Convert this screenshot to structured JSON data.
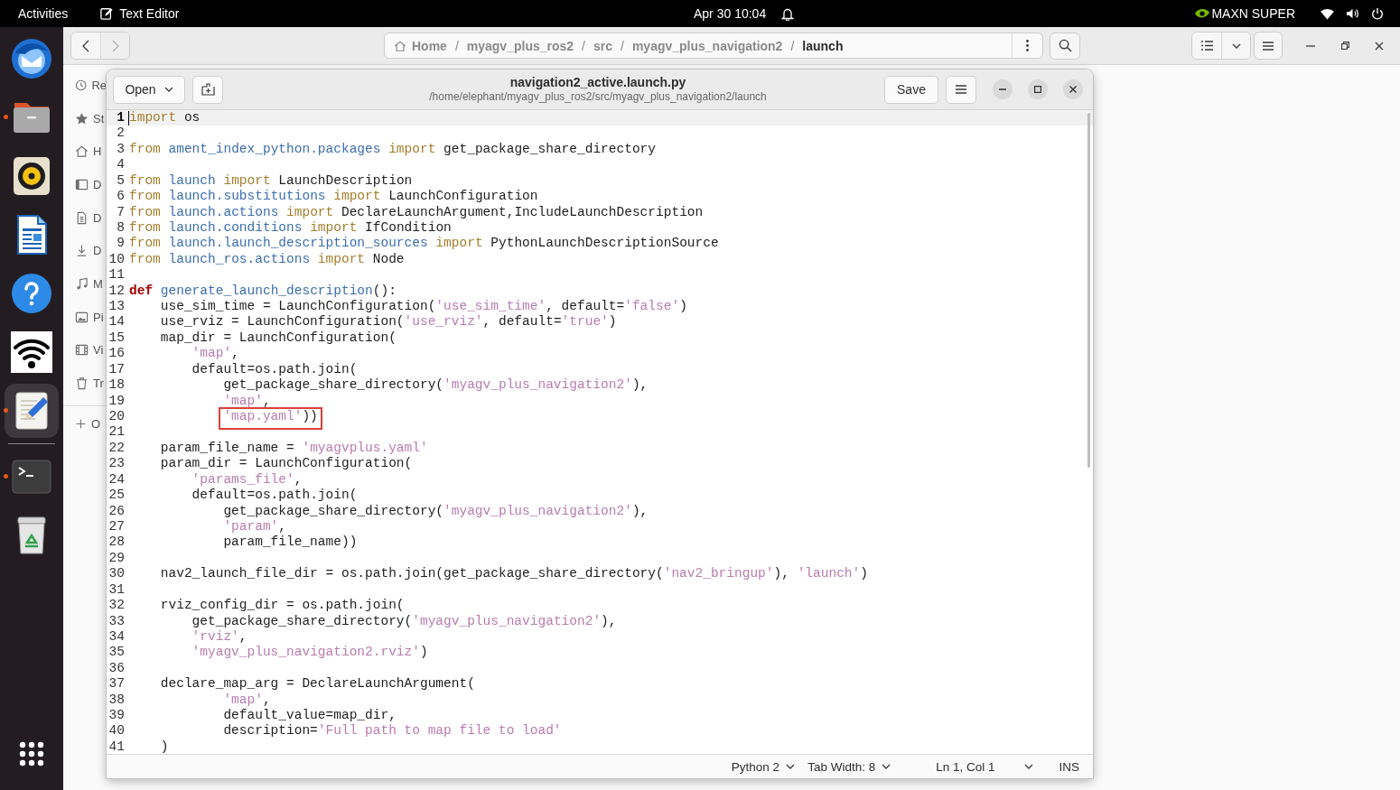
{
  "top_bar": {
    "activities": "Activities",
    "app_name": "Text Editor",
    "clock": "Apr 30 10:04",
    "power_mode": "MAXN SUPER"
  },
  "dock": {
    "favorites": [
      {
        "kind": "mail",
        "running": false,
        "selected": false
      },
      {
        "kind": "folder",
        "running": true,
        "selected": false
      },
      {
        "kind": "speaker",
        "running": false,
        "selected": false
      },
      {
        "kind": "document",
        "running": false,
        "selected": false
      },
      {
        "kind": "help",
        "running": false,
        "selected": false
      },
      {
        "kind": "wifi",
        "running": false,
        "selected": false
      },
      {
        "kind": "text-editor",
        "running": true,
        "selected": true
      }
    ],
    "others": [
      {
        "kind": "terminal",
        "running": true,
        "selected": false
      },
      {
        "kind": "trash",
        "running": false,
        "selected": false
      }
    ]
  },
  "file_manager": {
    "back_button": {
      "disabled": false
    },
    "forward_button": {
      "disabled": true
    },
    "path_bar": {
      "separator": "/",
      "segments": [
        {
          "kind": "home",
          "label": "Home",
          "selected": false
        },
        {
          "kind": "folder",
          "label": "myagv_plus_ros2",
          "selected": false
        },
        {
          "kind": "folder",
          "label": "src",
          "selected": false
        },
        {
          "kind": "folder",
          "label": "myagv_plus_navigation2",
          "selected": false
        },
        {
          "kind": "folder",
          "label": "launch",
          "selected": true
        }
      ]
    },
    "sidebar": [
      {
        "kind": "recent",
        "label": "Re"
      },
      {
        "kind": "starred",
        "label": "St"
      },
      {
        "kind": "home",
        "label": "H"
      },
      {
        "kind": "desktop",
        "label": "D"
      },
      {
        "kind": "documents",
        "label": "D"
      },
      {
        "kind": "downloads",
        "label": "D"
      },
      {
        "kind": "music",
        "label": "M"
      },
      {
        "kind": "pictures",
        "label": "Pi"
      },
      {
        "kind": "videos",
        "label": "Vi"
      },
      {
        "kind": "trash",
        "label": "Tr"
      },
      {
        "kind": "other",
        "label": "O"
      }
    ]
  },
  "editor": {
    "open_button": "Open",
    "title": "navigation2_active.launch.py",
    "path": "/home/elephant/myagv_plus_ros2/src/myagv_plus_navigation2/launch",
    "save_button": "Save",
    "lines": [
      {
        "no": "1",
        "current": true,
        "tokens": [
          {
            "kind": "keyword",
            "text": "import"
          },
          {
            "kind": "plain",
            "text": " os"
          }
        ]
      },
      {
        "no": "2",
        "current": false
      },
      {
        "no": "3",
        "current": false,
        "tokens": [
          {
            "kind": "keyword",
            "text": "from"
          },
          {
            "kind": "module",
            "text": " ament_index_python.packages"
          },
          {
            "kind": "keyword",
            "text": " import"
          },
          {
            "kind": "plain",
            "text": " get_package_share_directory"
          }
        ]
      },
      {
        "no": "4",
        "current": false
      },
      {
        "no": "5",
        "current": false,
        "tokens": [
          {
            "kind": "keyword",
            "text": "from"
          },
          {
            "kind": "module",
            "text": " launch"
          },
          {
            "kind": "keyword",
            "text": " import"
          },
          {
            "kind": "plain",
            "text": " LaunchDescription"
          }
        ]
      },
      {
        "no": "6",
        "current": false,
        "tokens": [
          {
            "kind": "keyword",
            "text": "from"
          },
          {
            "kind": "module",
            "text": " launch.substitutions"
          },
          {
            "kind": "keyword",
            "text": " import"
          },
          {
            "kind": "plain",
            "text": " LaunchConfiguration"
          }
        ]
      },
      {
        "no": "7",
        "current": false,
        "tokens": [
          {
            "kind": "keyword",
            "text": "from"
          },
          {
            "kind": "module",
            "text": " launch.actions"
          },
          {
            "kind": "keyword",
            "text": " import"
          },
          {
            "kind": "plain",
            "text": " DeclareLaunchArgument,IncludeLaunchDescription"
          }
        ]
      },
      {
        "no": "8",
        "current": false,
        "tokens": [
          {
            "kind": "keyword",
            "text": "from"
          },
          {
            "kind": "module",
            "text": " launch.conditions"
          },
          {
            "kind": "keyword",
            "text": " import"
          },
          {
            "kind": "plain",
            "text": " IfCondition"
          }
        ]
      },
      {
        "no": "9",
        "current": false,
        "tokens": [
          {
            "kind": "keyword",
            "text": "from"
          },
          {
            "kind": "module",
            "text": " launch.launch_description_sources"
          },
          {
            "kind": "keyword",
            "text": " import"
          },
          {
            "kind": "plain",
            "text": " PythonLaunchDescriptionSource"
          }
        ]
      },
      {
        "no": "10",
        "current": false,
        "tokens": [
          {
            "kind": "keyword",
            "text": "from"
          },
          {
            "kind": "module",
            "text": " launch_ros.actions"
          },
          {
            "kind": "keyword",
            "text": " import"
          },
          {
            "kind": "plain",
            "text": " Node"
          }
        ]
      },
      {
        "no": "11",
        "current": false
      },
      {
        "no": "12",
        "current": false,
        "tokens": [
          {
            "kind": "def",
            "text": "def"
          },
          {
            "kind": "function",
            "text": " generate_launch_description"
          },
          {
            "kind": "plain",
            "text": "():"
          }
        ]
      },
      {
        "no": "13",
        "current": false,
        "tokens": [
          {
            "kind": "plain",
            "text": "    use_sim_time = LaunchConfiguration("
          },
          {
            "kind": "string",
            "text": "'use_sim_time'"
          },
          {
            "kind": "plain",
            "text": ", default="
          },
          {
            "kind": "string",
            "text": "'false'"
          },
          {
            "kind": "plain",
            "text": ")"
          }
        ]
      },
      {
        "no": "14",
        "current": false,
        "tokens": [
          {
            "kind": "plain",
            "text": "    use_rviz = LaunchConfiguration("
          },
          {
            "kind": "string",
            "text": "'use_rviz'"
          },
          {
            "kind": "plain",
            "text": ", default="
          },
          {
            "kind": "string",
            "text": "'true'"
          },
          {
            "kind": "plain",
            "text": ")"
          }
        ]
      },
      {
        "no": "15",
        "current": false,
        "tokens": [
          {
            "kind": "plain",
            "text": "    map_dir = LaunchConfiguration("
          }
        ]
      },
      {
        "no": "16",
        "current": false,
        "tokens": [
          {
            "kind": "string",
            "text": "        'map'"
          },
          {
            "kind": "plain",
            "text": ","
          }
        ]
      },
      {
        "no": "17",
        "current": false,
        "tokens": [
          {
            "kind": "plain",
            "text": "        default=os.path.join("
          }
        ]
      },
      {
        "no": "18",
        "current": false,
        "tokens": [
          {
            "kind": "plain",
            "text": "            get_package_share_directory("
          },
          {
            "kind": "string",
            "text": "'myagv_plus_navigation2'"
          },
          {
            "kind": "plain",
            "text": "),"
          }
        ]
      },
      {
        "no": "19",
        "current": false,
        "tokens": [
          {
            "kind": "string",
            "text": "            'map'"
          },
          {
            "kind": "plain",
            "text": ","
          }
        ]
      },
      {
        "no": "20",
        "current": false,
        "tokens": [
          {
            "kind": "boxed",
            "tokens": [
              {
                "kind": "string",
                "text": "            'map.yaml'"
              },
              {
                "kind": "plain",
                "text": "))"
              }
            ]
          }
        ]
      },
      {
        "no": "21",
        "current": false
      },
      {
        "no": "22",
        "current": false,
        "tokens": [
          {
            "kind": "plain",
            "text": "    param_file_name = "
          },
          {
            "kind": "string",
            "text": "'myagvplus.yaml'"
          }
        ]
      },
      {
        "no": "23",
        "current": false,
        "tokens": [
          {
            "kind": "plain",
            "text": "    param_dir = LaunchConfiguration("
          }
        ]
      },
      {
        "no": "24",
        "current": false,
        "tokens": [
          {
            "kind": "string",
            "text": "        'params_file'"
          },
          {
            "kind": "plain",
            "text": ","
          }
        ]
      },
      {
        "no": "25",
        "current": false,
        "tokens": [
          {
            "kind": "plain",
            "text": "        default=os.path.join("
          }
        ]
      },
      {
        "no": "26",
        "current": false,
        "tokens": [
          {
            "kind": "plain",
            "text": "            get_package_share_directory("
          },
          {
            "kind": "string",
            "text": "'myagv_plus_navigation2'"
          },
          {
            "kind": "plain",
            "text": "),"
          }
        ]
      },
      {
        "no": "27",
        "current": false,
        "tokens": [
          {
            "kind": "string",
            "text": "            'param'"
          },
          {
            "kind": "plain",
            "text": ","
          }
        ]
      },
      {
        "no": "28",
        "current": false,
        "tokens": [
          {
            "kind": "plain",
            "text": "            param_file_name))"
          }
        ]
      },
      {
        "no": "29",
        "current": false
      },
      {
        "no": "30",
        "current": false,
        "tokens": [
          {
            "kind": "plain",
            "text": "    nav2_launch_file_dir = os.path.join(get_package_share_directory("
          },
          {
            "kind": "string",
            "text": "'nav2_bringup'"
          },
          {
            "kind": "plain",
            "text": "), "
          },
          {
            "kind": "string",
            "text": "'launch'"
          },
          {
            "kind": "plain",
            "text": ")"
          }
        ]
      },
      {
        "no": "31",
        "current": false
      },
      {
        "no": "32",
        "current": false,
        "tokens": [
          {
            "kind": "plain",
            "text": "    rviz_config_dir = os.path.join("
          }
        ]
      },
      {
        "no": "33",
        "current": false,
        "tokens": [
          {
            "kind": "plain",
            "text": "        get_package_share_directory("
          },
          {
            "kind": "string",
            "text": "'myagv_plus_navigation2'"
          },
          {
            "kind": "plain",
            "text": "),"
          }
        ]
      },
      {
        "no": "34",
        "current": false,
        "tokens": [
          {
            "kind": "string",
            "text": "        'rviz'"
          },
          {
            "kind": "plain",
            "text": ","
          }
        ]
      },
      {
        "no": "35",
        "current": false,
        "tokens": [
          {
            "kind": "string",
            "text": "        'myagv_plus_navigation2.rviz'"
          },
          {
            "kind": "plain",
            "text": ")"
          }
        ]
      },
      {
        "no": "36",
        "current": false
      },
      {
        "no": "37",
        "current": false,
        "tokens": [
          {
            "kind": "plain",
            "text": "    declare_map_arg = DeclareLaunchArgument("
          }
        ]
      },
      {
        "no": "38",
        "current": false,
        "tokens": [
          {
            "kind": "string",
            "text": "            'map'"
          },
          {
            "kind": "plain",
            "text": ","
          }
        ]
      },
      {
        "no": "39",
        "current": false,
        "tokens": [
          {
            "kind": "plain",
            "text": "            default_value=map_dir,"
          }
        ]
      },
      {
        "no": "40",
        "current": false,
        "tokens": [
          {
            "kind": "plain",
            "text": "            description="
          },
          {
            "kind": "string",
            "text": "'Full path to map file to load'"
          }
        ]
      },
      {
        "no": "41",
        "current": false,
        "tokens": [
          {
            "kind": "plain",
            "text": "    )"
          }
        ]
      }
    ],
    "status_bar": {
      "language": "Python 2",
      "tab_width": "Tab Width: 8",
      "position": "Ln 1, Col 1",
      "mode": "INS"
    }
  }
}
